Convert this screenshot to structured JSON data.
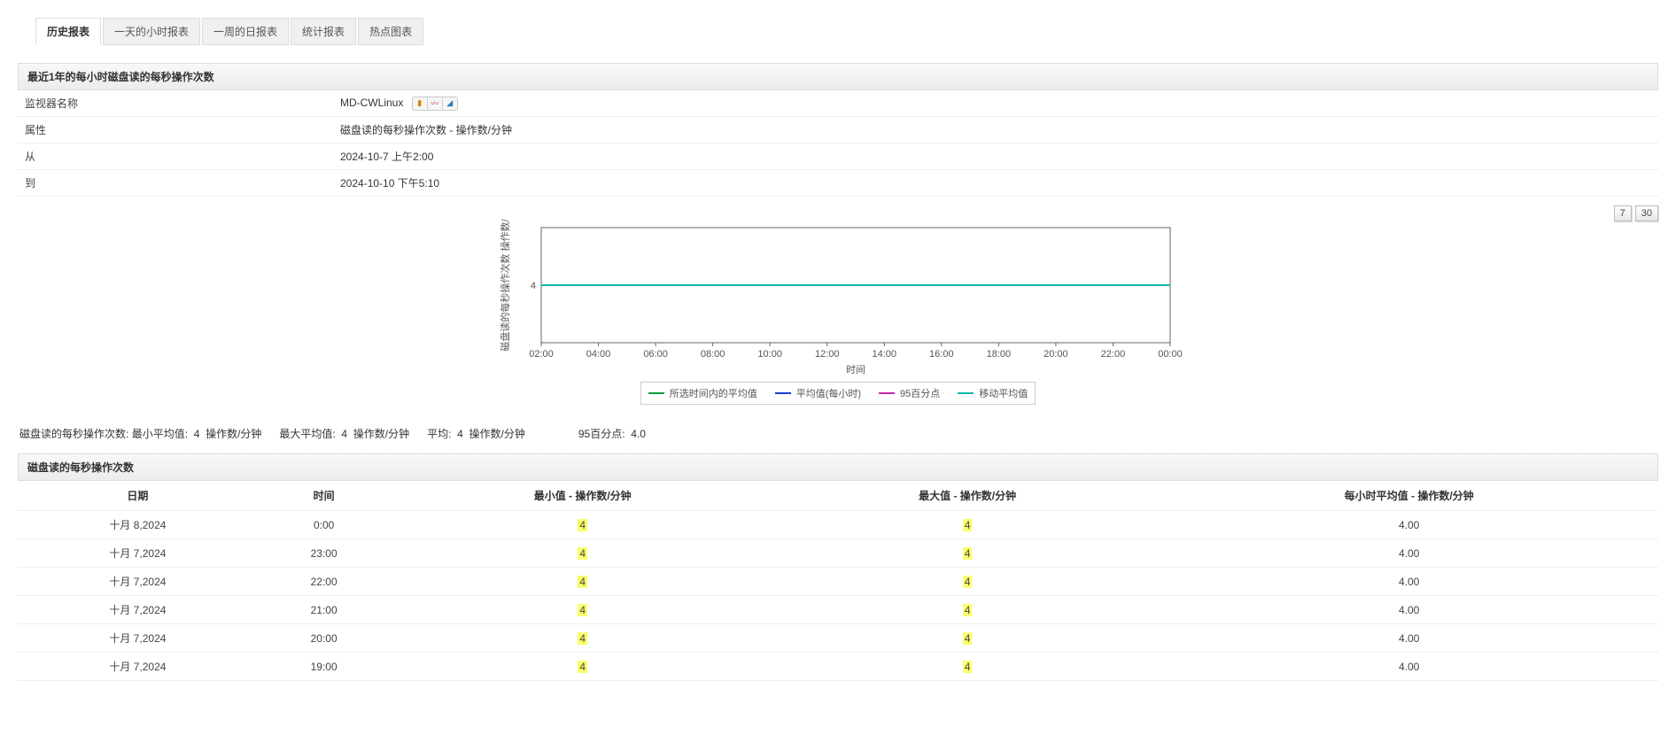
{
  "tabs": {
    "items": [
      {
        "label": "历史报表",
        "active": true
      },
      {
        "label": "一天的小时报表",
        "active": false
      },
      {
        "label": "一周的日报表",
        "active": false
      },
      {
        "label": "统计报表",
        "active": false
      },
      {
        "label": "热点图表",
        "active": false
      }
    ]
  },
  "section1_title": "最近1年的每小时磁盘读的每秒操作次数",
  "info": {
    "monitor_name_label": "监视器名称",
    "monitor_name_value": "MD-CWLinux",
    "attribute_label": "属性",
    "attribute_value": "磁盘读的每秒操作次数 - 操作数/分钟",
    "from_label": "从",
    "from_value": "2024-10-7 上午2:00",
    "to_label": "到",
    "to_value": "2024-10-10 下午5:10"
  },
  "range_buttons": {
    "btn7": "7",
    "btn30": "30"
  },
  "chart_data": {
    "type": "line",
    "title": "",
    "xlabel": "时间",
    "ylabel": "磁盘读的每秒操作次数 操作数/",
    "yticks": [
      4
    ],
    "xticks": [
      "02:00",
      "04:00",
      "06:00",
      "08:00",
      "10:00",
      "12:00",
      "14:00",
      "16:00",
      "18:00",
      "20:00",
      "22:00",
      "00:00"
    ],
    "ylim": [
      3,
      5
    ],
    "series": [
      {
        "name": "所选时间内的平均值",
        "color": "#0a9b3a",
        "values": [
          4,
          4,
          4,
          4,
          4,
          4,
          4,
          4,
          4,
          4,
          4,
          4
        ]
      },
      {
        "name": "平均值(每小时)",
        "color": "#1a3fd6",
        "values": [
          4,
          4,
          4,
          4,
          4,
          4,
          4,
          4,
          4,
          4,
          4,
          4
        ]
      },
      {
        "name": "95百分点",
        "color": "#c02bb3",
        "values": [
          4,
          4,
          4,
          4,
          4,
          4,
          4,
          4,
          4,
          4,
          4,
          4
        ]
      },
      {
        "name": "移动平均值",
        "color": "#0fb7b0",
        "values": [
          4,
          4,
          4,
          4,
          4,
          4,
          4,
          4,
          4,
          4,
          4,
          4
        ]
      }
    ]
  },
  "stats": {
    "prefix": "磁盘读的每秒操作次数:",
    "min_label": "最小平均值:",
    "min_value": "4",
    "unit": "操作数/分钟",
    "max_label": "最大平均值:",
    "max_value": "4",
    "avg_label": "平均:",
    "avg_value": "4",
    "p95_label": "95百分点:",
    "p95_value": "4.0"
  },
  "section2_title": "磁盘读的每秒操作次数",
  "table": {
    "headers": {
      "date": "日期",
      "time": "时间",
      "min": "最小值 - 操作数/分钟",
      "max": "最大值 - 操作数/分钟",
      "avg": "每小时平均值 - 操作数/分钟"
    },
    "rows": [
      {
        "date": "十月 8,2024",
        "time": "0:00",
        "min": "4",
        "max": "4",
        "avg": "4.00"
      },
      {
        "date": "十月 7,2024",
        "time": "23:00",
        "min": "4",
        "max": "4",
        "avg": "4.00"
      },
      {
        "date": "十月 7,2024",
        "time": "22:00",
        "min": "4",
        "max": "4",
        "avg": "4.00"
      },
      {
        "date": "十月 7,2024",
        "time": "21:00",
        "min": "4",
        "max": "4",
        "avg": "4.00"
      },
      {
        "date": "十月 7,2024",
        "time": "20:00",
        "min": "4",
        "max": "4",
        "avg": "4.00"
      },
      {
        "date": "十月 7,2024",
        "time": "19:00",
        "min": "4",
        "max": "4",
        "avg": "4.00"
      }
    ]
  }
}
